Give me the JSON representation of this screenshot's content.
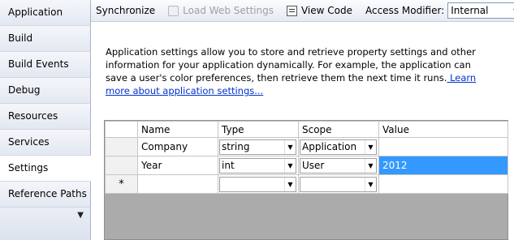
{
  "nav": {
    "items": [
      {
        "label": "Application"
      },
      {
        "label": "Build"
      },
      {
        "label": "Build Events"
      },
      {
        "label": "Debug"
      },
      {
        "label": "Resources"
      },
      {
        "label": "Services"
      },
      {
        "label": "Settings",
        "selected": true
      },
      {
        "label": "Reference Paths"
      }
    ],
    "more_icon": "chevron-down-icon"
  },
  "toolbar": {
    "synchronize_label": "Synchronize",
    "load_web_settings_label": "Load Web Settings",
    "view_code_label": "View Code",
    "access_modifier_label": "Access Modifier:",
    "access_modifier_value": "Internal"
  },
  "description": {
    "text": "Application settings allow you to store and retrieve property settings and other information for your application dynamically. For example, the application can save a user's color preferences, then retrieve them the next time it runs.",
    "link": " Learn more about application settings..."
  },
  "grid": {
    "columns": [
      "Name",
      "Type",
      "Scope",
      "Value"
    ],
    "rows": [
      {
        "name": "Company",
        "type": "string",
        "scope": "Application",
        "value": ""
      },
      {
        "name": "Year",
        "type": "int",
        "scope": "User",
        "value": "2012"
      }
    ],
    "new_row_marker": "*",
    "selection_color": "#3399ff"
  }
}
